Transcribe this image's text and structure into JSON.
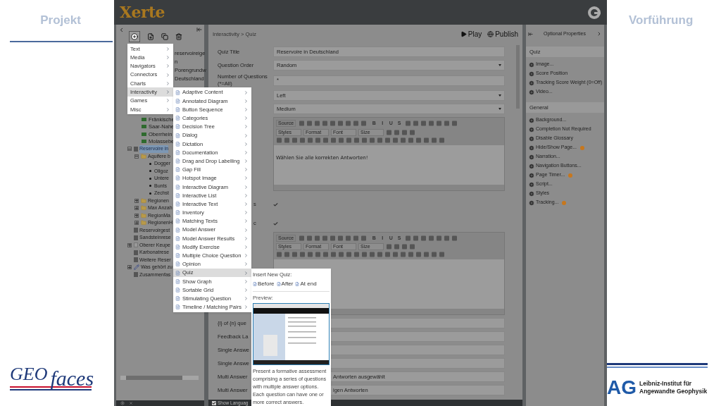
{
  "slide": {
    "title": "Projekt",
    "subtitle": "Vorführung",
    "logo_left": {
      "part1": "GEO",
      "part2": "faces"
    },
    "logo_right": {
      "mark": "AG",
      "line1": "Leibniz-Institut für",
      "line2": "Angewandte Geophysik"
    }
  },
  "app": {
    "logo": "Xerte",
    "tree": {
      "fragments": [
        {
          "label": "reservoireige"
        },
        {
          "label": "n"
        },
        {
          "label": "Porengrundw"
        },
        {
          "label": "Deutschland"
        }
      ],
      "sub_items": [
        {
          "label": "Fränkische",
          "selected": false
        },
        {
          "label": "Saar-Nahe",
          "selected": false
        },
        {
          "label": "Oberrhein",
          "selected": false
        },
        {
          "label": "Molassebe",
          "selected": false
        }
      ],
      "items": [
        {
          "label": "Reservoire in",
          "kind": "page",
          "selected": true,
          "expanded": true,
          "children": [
            {
              "label": "Aquifere b",
              "kind": "folder",
              "selected": false,
              "expanded": true,
              "children": [
                {
                  "label": "Dogger",
                  "kind": "bullet",
                  "selected": false
                },
                {
                  "label": "Oligoz",
                  "kind": "bullet",
                  "selected": false
                },
                {
                  "label": "Untere",
                  "kind": "bullet",
                  "selected": false
                },
                {
                  "label": "Bunts",
                  "kind": "bullet",
                  "selected": false
                },
                {
                  "label": "Zechst",
                  "kind": "bullet",
                  "selected": false
                }
              ]
            },
            {
              "label": "Regionen",
              "kind": "folder",
              "selected": false,
              "expanded": false
            },
            {
              "label": "Max Anzah",
              "kind": "folder",
              "selected": false,
              "expanded": false
            },
            {
              "label": "RegionMa",
              "kind": "folder",
              "selected": false,
              "expanded": false
            },
            {
              "label": "RegionenH",
              "kind": "folder",
              "selected": false,
              "expanded": false
            }
          ]
        },
        {
          "label": "Reservoirgest",
          "kind": "page",
          "selected": false
        },
        {
          "label": "Sandsteinrese",
          "kind": "page",
          "selected": false
        },
        {
          "label": "Oberer Keupe",
          "kind": "blank",
          "selected": false,
          "expanded": false
        },
        {
          "label": "Karbonatrese",
          "kind": "page",
          "selected": false
        },
        {
          "label": "Weitere Reser",
          "kind": "page",
          "selected": false
        },
        {
          "label": "Was gehört zu",
          "kind": "pen",
          "selected": false,
          "expanded": false
        },
        {
          "label": "Zusammenfas",
          "kind": "page",
          "selected": false
        }
      ]
    },
    "insert_menu": [
      {
        "label": "Text",
        "selected": false
      },
      {
        "label": "Media",
        "selected": false
      },
      {
        "label": "Navigators",
        "selected": false
      },
      {
        "label": "Connectors",
        "selected": false
      },
      {
        "label": "Charts",
        "selected": false
      },
      {
        "label": "Interactivity",
        "selected": true
      },
      {
        "label": "Games",
        "selected": false
      },
      {
        "label": "Misc",
        "selected": false
      }
    ],
    "submenu": [
      {
        "label": "Adaptive Content",
        "selected": false
      },
      {
        "label": "Annotated Diagram",
        "selected": false
      },
      {
        "label": "Button Sequence",
        "selected": false
      },
      {
        "label": "Categories",
        "selected": false
      },
      {
        "label": "Decision Tree",
        "selected": false
      },
      {
        "label": "Dialog",
        "selected": false
      },
      {
        "label": "Dictation",
        "selected": false
      },
      {
        "label": "Documentation",
        "selected": false
      },
      {
        "label": "Drag and Drop Labelling",
        "selected": false
      },
      {
        "label": "Gap Fill",
        "selected": false
      },
      {
        "label": "Hotspot Image",
        "selected": false
      },
      {
        "label": "Interactive Diagram",
        "selected": false
      },
      {
        "label": "Interactive List",
        "selected": false
      },
      {
        "label": "Interactive Text",
        "selected": false
      },
      {
        "label": "Inventory",
        "selected": false
      },
      {
        "label": "Matching Texts",
        "selected": false
      },
      {
        "label": "Model Answer",
        "selected": false
      },
      {
        "label": "Model Answer Results",
        "selected": false
      },
      {
        "label": "Modify Exercise",
        "selected": false
      },
      {
        "label": "Multiple Choice Question",
        "selected": false
      },
      {
        "label": "Opinion",
        "selected": false
      },
      {
        "label": "Quiz",
        "selected": true
      },
      {
        "label": "Show Graph",
        "selected": false
      },
      {
        "label": "Sortable Grid",
        "selected": false
      },
      {
        "label": "Stimulating Question",
        "selected": false
      },
      {
        "label": "Timeline / Matching Pairs",
        "selected": false
      }
    ],
    "quiz_panel": {
      "heading": "Insert New Quiz:",
      "buttons": [
        "Before",
        "After",
        "At end"
      ],
      "preview_label": "Preview:",
      "description": "Present a formative assessment comprising a series of questions with multiple answer options. Each question can have one or more correct answers."
    },
    "editor": {
      "breadcrumb": "Interactivity > Quiz",
      "actions": [
        "Play",
        "Publish"
      ],
      "fields": [
        {
          "kind": "text",
          "label": "Quiz Title",
          "value": "Reservoire in Deutschland"
        },
        {
          "kind": "select",
          "label": "Question Order",
          "value": "Random"
        },
        {
          "kind": "text",
          "label": "Number of Questions (*=All)",
          "value": "*"
        },
        {
          "kind": "select",
          "value": "Left"
        },
        {
          "kind": "select",
          "value": "Medium"
        },
        {
          "kind": "editor",
          "value": "Wählen Sie alle korrekten Antworten!",
          "toolbar": {
            "source": "Source",
            "format_buttons": [
              "B",
              "I",
              "U",
              "S"
            ],
            "dropdowns": [
              "Styles",
              "Format",
              "Font",
              "Size"
            ]
          }
        },
        {
          "kind": "checkbox",
          "label": "s",
          "checked": true
        },
        {
          "kind": "checkbox",
          "label": "c",
          "checked": true
        },
        {
          "kind": "editor",
          "toolbar": {
            "source": "Source",
            "format_buttons": [
              "B",
              "I",
              "U",
              "S"
            ],
            "dropdowns": [
              "Styles",
              "Format",
              "Font",
              "Size"
            ]
          }
        },
        {
          "kind": "text",
          "label": "{i} of {n} que"
        },
        {
          "kind": "text",
          "label": "Feedback La"
        },
        {
          "kind": "text",
          "label": "Single Answe"
        },
        {
          "kind": "text",
          "label": "Single Answe"
        },
        {
          "kind": "text",
          "label": "Multi Answer",
          "value": "Antworten ausgewählt"
        },
        {
          "kind": "text",
          "label": "Multi Answer",
          "value": "igen Antworten"
        }
      ],
      "footer": {
        "label": "Show Languag",
        "checked": true
      }
    },
    "properties": {
      "title": "Optional Properties",
      "sections": [
        {
          "title": "Quiz",
          "items": [
            {
              "label": "Image...",
              "info": false
            },
            {
              "label": "Score Position",
              "info": false
            },
            {
              "label": "Tracking Score Weight (0=Off)",
              "info": false
            },
            {
              "label": "Video...",
              "info": false
            }
          ]
        },
        {
          "title": "General",
          "items": [
            {
              "label": "Background...",
              "info": false
            },
            {
              "label": "Completion Not Required",
              "info": false
            },
            {
              "label": "Disable Glossary",
              "info": false
            },
            {
              "label": "Hide/Show Page...",
              "info": true
            },
            {
              "label": "Narration...",
              "info": false
            },
            {
              "label": "Navigation Buttons...",
              "info": false
            },
            {
              "label": "Page Timer...",
              "info": true
            },
            {
              "label": "Script...",
              "info": false
            },
            {
              "label": "Styles",
              "info": false
            },
            {
              "label": "Tracking...",
              "info": true
            }
          ]
        }
      ]
    }
  }
}
